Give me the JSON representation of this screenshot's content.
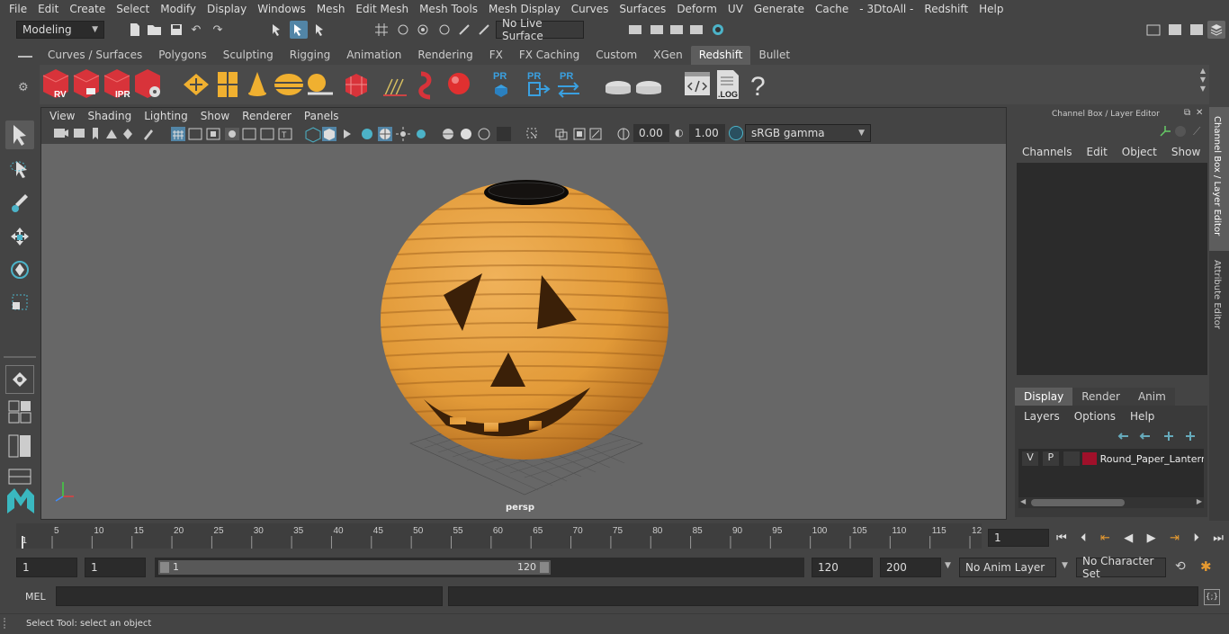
{
  "menus": [
    "File",
    "Edit",
    "Create",
    "Select",
    "Modify",
    "Display",
    "Windows",
    "Mesh",
    "Edit Mesh",
    "Mesh Tools",
    "Mesh Display",
    "Curves",
    "Surfaces",
    "Deform",
    "UV",
    "Generate",
    "Cache",
    "- 3DtoAll -",
    "Redshift",
    "Help"
  ],
  "status": {
    "mode": "Modeling",
    "live_surface": "No Live Surface"
  },
  "shelf_tabs": [
    "Curves / Surfaces",
    "Polygons",
    "Sculpting",
    "Rigging",
    "Animation",
    "Rendering",
    "FX",
    "FX Caching",
    "Custom",
    "XGen",
    "Redshift",
    "Bullet"
  ],
  "shelf_active": "Redshift",
  "shelf_labels": {
    "rv": "RV",
    "ipr": "IPR",
    "pr1": "PR",
    "pr2": "PR",
    "pr3": "PR",
    "log": ".LOG",
    "help": "?"
  },
  "viewport": {
    "menus": [
      "View",
      "Shading",
      "Lighting",
      "Show",
      "Renderer",
      "Panels"
    ],
    "exposure": "0.00",
    "gamma": "1.00",
    "color_space": "sRGB gamma",
    "camera_label": "persp"
  },
  "channel_box": {
    "title": "Channel Box / Layer Editor",
    "menus": [
      "Channels",
      "Edit",
      "Object",
      "Show"
    ],
    "tabs": [
      "Display",
      "Render",
      "Anim"
    ],
    "active_tab": "Display",
    "layer_menus": [
      "Layers",
      "Options",
      "Help"
    ],
    "layer": {
      "v": "V",
      "p": "P",
      "name": "Round_Paper_Lantern",
      "color": "#a0102a"
    }
  },
  "side_tabs": [
    "Channel Box / Layer Editor",
    "Attribute Editor"
  ],
  "timeline": {
    "ticks": [
      "5",
      "10",
      "15",
      "20",
      "25",
      "30",
      "35",
      "40",
      "45",
      "50",
      "55",
      "60",
      "65",
      "70",
      "75",
      "80",
      "85",
      "90",
      "95",
      "100",
      "105",
      "110",
      "115",
      "12"
    ],
    "start_marker": "1",
    "current_frame": "1"
  },
  "range": {
    "start": "1",
    "playback_start": "1",
    "slider_start": "1",
    "slider_end": "120",
    "end": "120",
    "anim_end": "200",
    "anim_layer": "No Anim Layer",
    "character_set": "No Character Set"
  },
  "command": {
    "lang": "MEL"
  },
  "help_text": "Select Tool: select an object",
  "colors": {
    "accent": "#5285a6",
    "lantern": "#e7a03c",
    "face": "#3b2008",
    "layer_red": "#a0102a"
  }
}
